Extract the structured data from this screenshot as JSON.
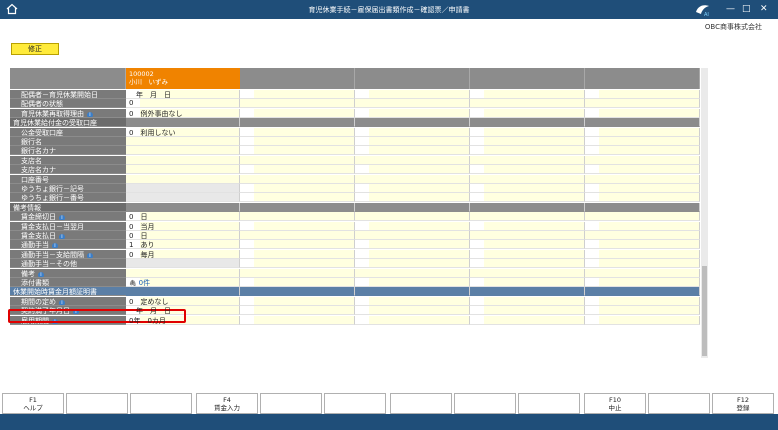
{
  "window": {
    "title": "育児休業手続－雇保届出書類作成－確認票／申請書",
    "company": "OBC商事株式会社"
  },
  "toolbar": {
    "edit_label": "修正"
  },
  "employee": {
    "code": "100002",
    "name": "小川　いずみ"
  },
  "rows": [
    {
      "label": "配偶者－育児休業開始日",
      "value": "　年　月　日"
    },
    {
      "label": "配偶者の状態",
      "value": "0"
    },
    {
      "label": "育児休業再取得理由",
      "info": true,
      "value": "0　例外事由なし"
    },
    {
      "label": "育児休業給付金の受取口座",
      "section": true
    },
    {
      "label": "公金受取口座",
      "value": "0　利用しない"
    },
    {
      "label": "銀行名",
      "value": ""
    },
    {
      "label": "銀行名カナ",
      "value": ""
    },
    {
      "label": "支店名",
      "value": ""
    },
    {
      "label": "支店名カナ",
      "value": ""
    },
    {
      "label": "口座番号",
      "value": ""
    },
    {
      "label": "ゆうちょ銀行－記号",
      "value": ""
    },
    {
      "label": "ゆうちょ銀行－番号",
      "value": ""
    },
    {
      "label": "備考情報",
      "section": true
    },
    {
      "label": "賃金締切日",
      "info": true,
      "value": "0　日"
    },
    {
      "label": "賃金支払日－当翌月",
      "value": "0　当月"
    },
    {
      "label": "賃金支払日",
      "info": true,
      "value": "0　日"
    },
    {
      "label": "通勤手当",
      "info": true,
      "value": "1　あり"
    },
    {
      "label": "通勤手当－支給間隔",
      "info": true,
      "value": "0　毎月"
    },
    {
      "label": "通勤手当－その他",
      "value": ""
    },
    {
      "label": "備考",
      "info": true,
      "value": ""
    },
    {
      "label": "添付書類",
      "value": "0件",
      "clip": true
    },
    {
      "label": "休業開始時賃金月額証明書",
      "blue": true
    },
    {
      "label": "期間の定め",
      "info": true,
      "value": "0　定めなし"
    },
    {
      "label": "契約満了年月日",
      "info": true,
      "value": "　年　月　日"
    },
    {
      "label": "雇用期間",
      "info": true,
      "value": "0年　0カ月"
    }
  ],
  "fkeys": [
    {
      "key": "F1",
      "label": "ヘルプ"
    },
    {
      "key": "",
      "label": ""
    },
    {
      "key": "",
      "label": ""
    },
    {
      "key": "F4",
      "label": "賃金入力"
    },
    {
      "key": "",
      "label": ""
    },
    {
      "key": "",
      "label": ""
    },
    {
      "key": "",
      "label": ""
    },
    {
      "key": "",
      "label": ""
    },
    {
      "key": "",
      "label": ""
    },
    {
      "key": "F10",
      "label": "中止"
    },
    {
      "key": "",
      "label": ""
    },
    {
      "key": "F12",
      "label": "登録"
    }
  ],
  "colors": {
    "title_bar": "#1f4e79",
    "employee_header": "#f08300",
    "input_bg": "#ffffe0",
    "highlight": "#e00000"
  },
  "icons": [
    "home-icon",
    "ai-assistant-icon",
    "minimize-icon",
    "maximize-icon",
    "close-icon",
    "info-icon",
    "paperclip-icon"
  ]
}
